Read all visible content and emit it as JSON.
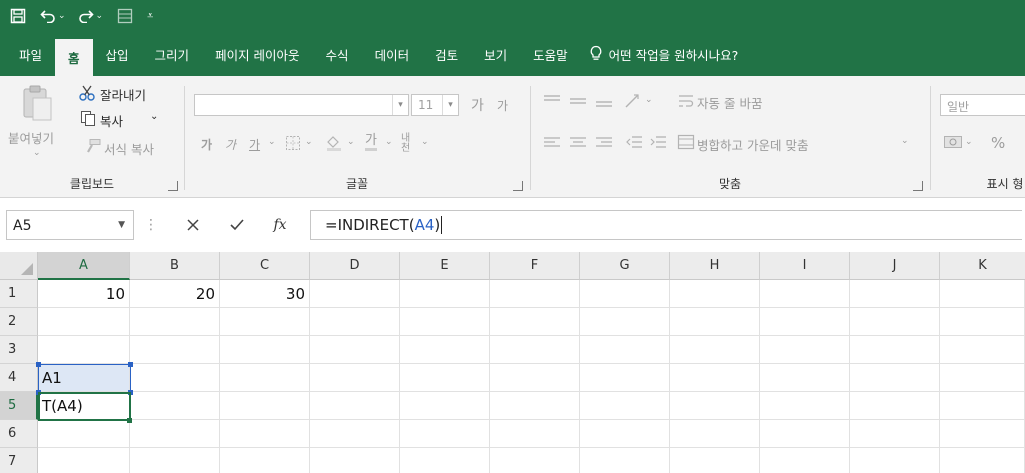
{
  "ribbon_tabs": [
    "파일",
    "홈",
    "삽입",
    "그리기",
    "페이지 레이아웃",
    "수식",
    "데이터",
    "검토",
    "보기",
    "도움말"
  ],
  "active_tab": "홈",
  "tell_me": "어떤 작업을 원하시나요?",
  "clipboard": {
    "paste": "붙여넣기",
    "cut": "잘라내기",
    "copy": "복사",
    "format_painter": "서식 복사",
    "label": "클립보드"
  },
  "font": {
    "font_name": "",
    "font_size": "11",
    "grow": "가",
    "shrink": "가",
    "bold": "가",
    "italic": "가",
    "underline": "가",
    "font_color": "가",
    "phonetic": "내천",
    "label": "글꼴"
  },
  "alignment": {
    "wrap_text": "자동 줄 바꿈",
    "merge_center": "병합하고 가운데 맞춤",
    "label": "맞춤"
  },
  "number": {
    "format": "일반",
    "percent": "%",
    "label": "표시 형"
  },
  "formula_bar": {
    "name_box": "A5",
    "fx": "fx",
    "formula_prefix": "=INDIRECT(",
    "formula_ref": "A4",
    "formula_suffix": ")"
  },
  "columns": [
    "A",
    "B",
    "C",
    "D",
    "E",
    "F",
    "G",
    "H",
    "I",
    "J",
    "K"
  ],
  "rows": [
    "1",
    "2",
    "3",
    "4",
    "5",
    "6",
    "7"
  ],
  "cells": {
    "A1": "10",
    "B1": "20",
    "C1": "30",
    "A4": "A1",
    "A5": "T(A4)"
  },
  "colors": {
    "brand_green": "#217346",
    "ref_blue": "#2a62c5"
  }
}
